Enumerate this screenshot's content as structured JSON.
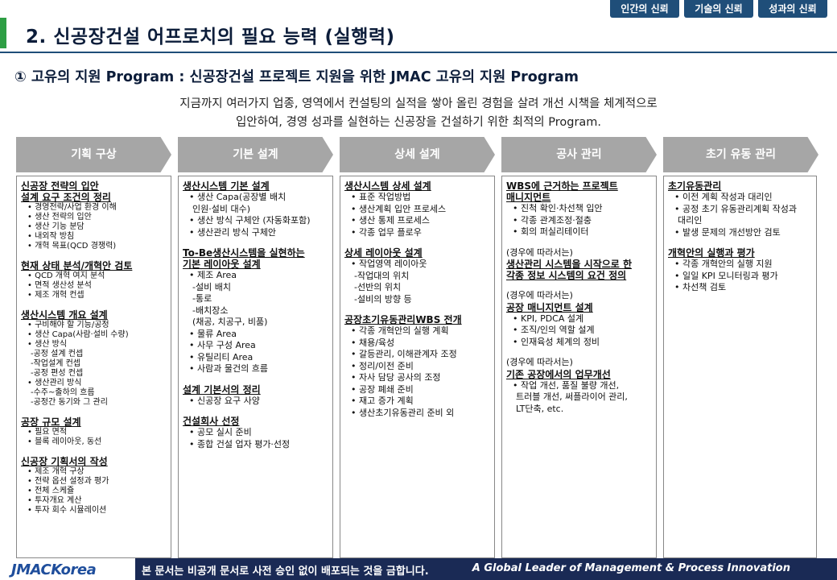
{
  "top_tabs": [
    "인간의 신뢰",
    "기술의 신뢰",
    "성과의 신뢰"
  ],
  "title": "2. 신공장건설 어프로치의 필요 능력 (실행력)",
  "subtitle": "① 고유의 지원 Program : 신공장건설 프로젝트 지원을 위한 JMAC 고유의 지원 Program",
  "intro": {
    "line1": "지금까지 여러가지 업종, 영역에서 컨설팅의 실적을 쌓아 올린 경험을 살려 개선 시책을 체계적으로",
    "line2": "입안하여, 경영 성과를 실현하는 신공장을 건설하기 위한 최적의 Program."
  },
  "phases": [
    "기획 구상",
    "기본 설계",
    "상세 설계",
    "공사 관리",
    "초기 유동 관리"
  ],
  "columns": [
    {
      "size": "small",
      "sections": [
        {
          "title": [
            "신공장 전략의 입안",
            "설계 요구 조건의 정리"
          ],
          "items": [
            "• 경영전략/사업 환경 이해",
            "• 생산 전략의 입안",
            "• 생산 기능 분담",
            "• 내외작 방침",
            "• 개혁 목표(QCD 경쟁력)"
          ]
        },
        {
          "title": [
            "현재 상태 분석/개혁안 검토"
          ],
          "items": [
            "• QCD 개혁 여지 분석",
            "• 면적 생산성 분석",
            "• 제조 개혁 컨셉"
          ]
        },
        {
          "title": [
            "생산시스템 개요 설계"
          ],
          "items": [
            "• 구비해야 할 기능/공정",
            "• 생산 Capa(사람·설비 수량)",
            "• 생산 방식",
            "-공정 설계 컨셉",
            "-작업설계 컨셉",
            "-공정 편성 컨셉",
            "• 생산관리 방식",
            "-수주~출하의 흐름",
            "-공정간 동기와 그 관리"
          ]
        },
        {
          "title": [
            "공장 규모 설계"
          ],
          "items": [
            "• 필요 면적",
            "• 블록 레이아웃, 동선"
          ]
        },
        {
          "title": [
            "신공장 기획서의 작성"
          ],
          "items": [
            "• 제조 개혁 구상",
            "• 전략 옵션 설정과 평가",
            "• 전체 스케쥴",
            "• 투자개요 계산",
            "• 투자 회수 시뮬레이션"
          ]
        }
      ]
    },
    {
      "size": "normal",
      "sections": [
        {
          "title": [
            "생산시스템 기본 설계"
          ],
          "items": [
            "• 생산 Capa(공장별 배치",
            "인원·설비 대수)",
            "• 생산 방식 구체안 (자동화포함)",
            "• 생산관리 방식 구체안"
          ]
        },
        {
          "title": [
            "To-Be생산시스템을 실현하는",
            "기본 레이아웃 설계"
          ],
          "items": [
            "• 제조 Area",
            "-설비 배치",
            "-통로",
            "-배치장소",
            "(채공, 치공구, 비품)",
            "• 물류 Area",
            "• 사무 구성 Area",
            "• 유틸리티 Area",
            "• 사람과 물건의 흐름"
          ]
        },
        {
          "title": [
            "설계 기본서의 정리"
          ],
          "items": [
            "• 신공장 요구 사양"
          ]
        },
        {
          "title": [
            "건설회사 선정"
          ],
          "items": [
            "• 공모 실시 준비",
            "• 종합 건설 업자 평가·선정"
          ]
        }
      ]
    },
    {
      "size": "normal",
      "sections": [
        {
          "title": [
            "생산시스템 상세 설계"
          ],
          "items": [
            "• 표준 작업방법",
            "• 생산계획 입안 프로세스",
            "• 생산 통제 프로세스",
            "• 각종 업무 플로우"
          ]
        },
        {
          "title": [
            "상세 레이아웃 설계"
          ],
          "items": [
            "• 작업영역 레이아웃",
            "-작업대의 위치",
            "-선반의 위치",
            "-설비의 방향 등"
          ]
        },
        {
          "title": [
            "공장초기유동관리WBS 전개"
          ],
          "items": [
            "• 각종 개혁안의 실행 계획",
            "• 채용/육성",
            "• 갈등관리, 이해관계자 조정",
            "• 정리/이전 준비",
            "• 자사 담당 공사의 조정",
            "• 공장 폐쇄 준비",
            "• 재고 증가 계획",
            "• 생산초기유동관리 준비 외"
          ]
        }
      ]
    },
    {
      "size": "normal",
      "sections": [
        {
          "title": [
            "WBS에 근거하는 프로젝트",
            "매니지먼트"
          ],
          "items": [
            "• 진척 확인·차선책 입안",
            "• 각종 관계조정·절충",
            "• 회의 퍼실리테이터"
          ]
        },
        {
          "note": "(경우에 따라서는)",
          "title": [
            "생산관리 시스템을 시작으로 한",
            "각종 정보 시스템의 요건 정의"
          ],
          "items": []
        },
        {
          "note": "(경우에 따라서는)",
          "title": [
            "공장 매니지먼트 설계"
          ],
          "items": [
            "• KPI, PDCA 설계",
            "• 조직/인의 역할 설계",
            "• 인재육성 체계의 정비"
          ]
        },
        {
          "note": "(경우에 따라서는)",
          "title": [
            "기존 공장에서의 업무개선"
          ],
          "items": [
            "• 작업 개선, 품질 불량 개선,",
            "트러블 개선, 써플라이어 관리,",
            "LT단축, etc."
          ]
        }
      ]
    },
    {
      "size": "normal",
      "sections": [
        {
          "title": [
            "초기유동관리"
          ],
          "items": [
            "• 이전 계획 작성과 대리인",
            "• 공정 초기 유동관리계획 작성과",
            "대리인",
            "• 발생 문제의 개선방안 검토"
          ]
        },
        {
          "title": [
            "개혁안의 실행과 평가"
          ],
          "items": [
            "• 각종 개혁안의 실행 지원",
            "• 일일 KPI 모니터링과 평가",
            "• 차선책 검토"
          ]
        }
      ]
    }
  ],
  "footer": {
    "logo": "JMACKorea",
    "notice": "본 문서는 비공개 문서로 사전 승인 없이 배포되는 것을 금합니다.",
    "slogan": "A Global Leader of Management & Process  Innovation"
  },
  "colors": {
    "navy": "#1a2a55",
    "accent_green": "#2e9e44",
    "tab_blue": "#1f4e79",
    "phase_gray": "#a6a6a6"
  }
}
